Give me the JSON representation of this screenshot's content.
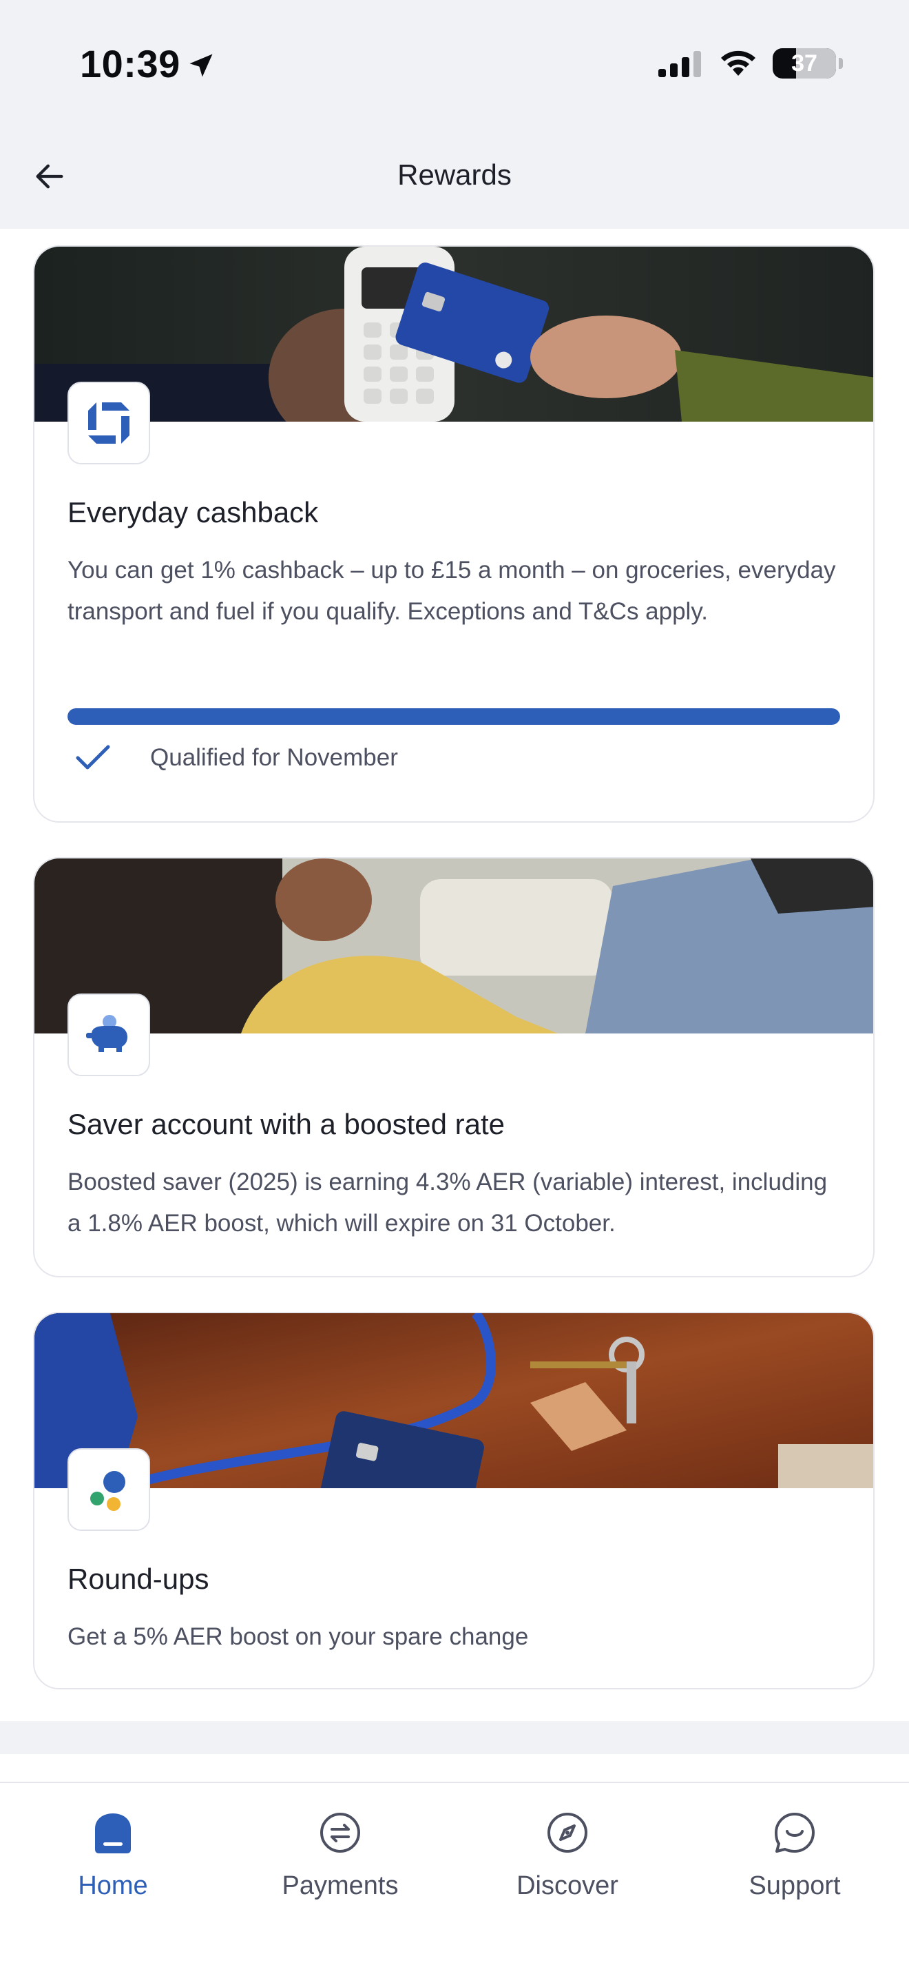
{
  "status_bar": {
    "time": "10:39",
    "battery": "37",
    "battery_level": 0.37
  },
  "header": {
    "title": "Rewards",
    "back_icon": "arrow-left-icon"
  },
  "cards": [
    {
      "title": "Everyday cashback",
      "text": "You can get 1% cashback – up to £15 a month – on groceries, everyday transport and fuel if you qualify. Exceptions and T&Cs apply.",
      "progress": 1.0,
      "status": "Qualified for November",
      "logo_icon": "chase-logo-icon",
      "brand_color": "#2e5fb8"
    },
    {
      "title": "Saver account with a boosted rate",
      "text": "Boosted saver (2025) is earning 4.3% AER (variable) interest, including a 1.8% AER boost, which will expire on 31 October.",
      "logo_icon": "piggy-bank-icon"
    },
    {
      "title": "Round-ups",
      "text": "Get a 5% AER boost on your spare change",
      "logo_icon": "round-ups-dots-icon"
    }
  ],
  "tabbar": {
    "items": [
      {
        "label": "Home",
        "icon": "home-icon",
        "active": true
      },
      {
        "label": "Payments",
        "icon": "payments-icon",
        "active": false
      },
      {
        "label": "Discover",
        "icon": "compass-icon",
        "active": false
      },
      {
        "label": "Support",
        "icon": "chat-bubble-icon",
        "active": false
      }
    ]
  },
  "colors": {
    "accent": "#2e5fb8",
    "background": "#f1f2f6"
  }
}
